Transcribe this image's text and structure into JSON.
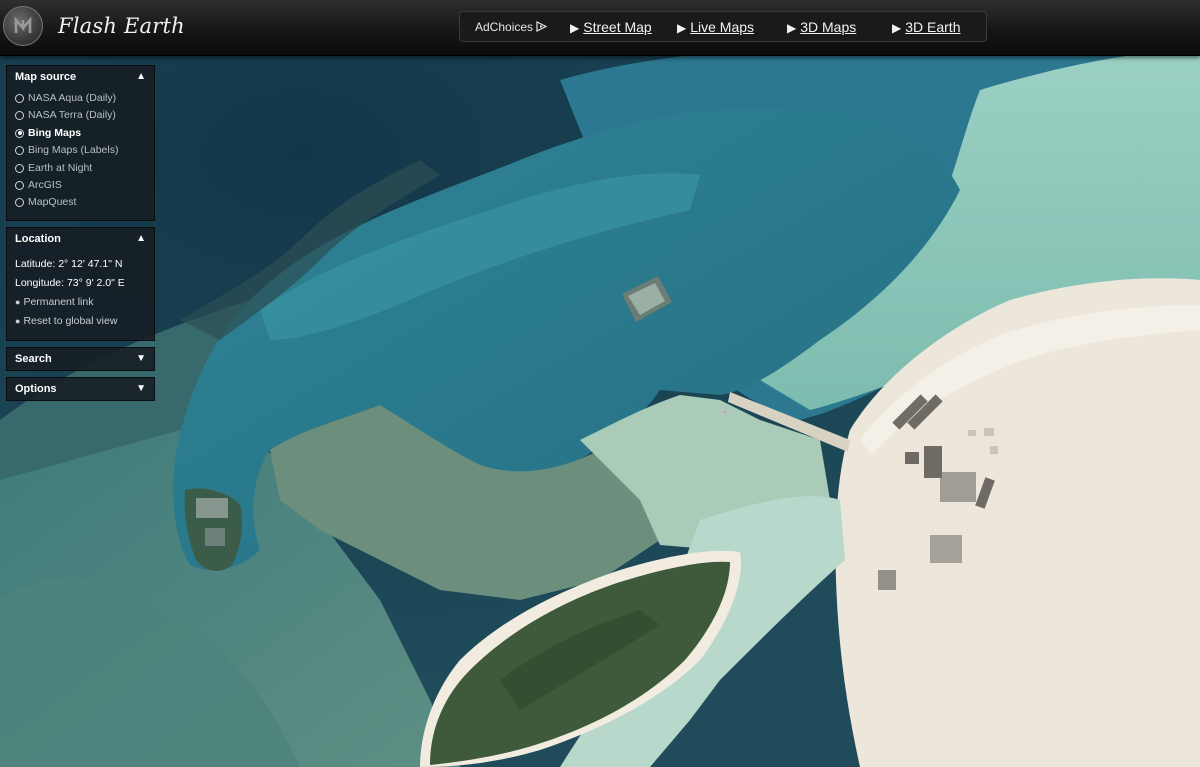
{
  "header": {
    "brand": "Flash Earth",
    "adchoices": "AdChoices",
    "nav": [
      {
        "label": "Street Map"
      },
      {
        "label": "Live Maps"
      },
      {
        "label": "3D Maps"
      },
      {
        "label": "3D Earth"
      }
    ]
  },
  "map_source": {
    "title": "Map source",
    "options": [
      {
        "label": "NASA Aqua (Daily)",
        "selected": false
      },
      {
        "label": "NASA Terra (Daily)",
        "selected": false
      },
      {
        "label": "Bing Maps",
        "selected": true
      },
      {
        "label": "Bing Maps (Labels)",
        "selected": false
      },
      {
        "label": "Earth at Night",
        "selected": false
      },
      {
        "label": "ArcGIS",
        "selected": false
      },
      {
        "label": "MapQuest",
        "selected": false
      }
    ]
  },
  "location": {
    "title": "Location",
    "latitude": "Latitude: 2° 12' 47.1\" N",
    "longitude": "Longitude: 73° 9' 2.0\" E",
    "permanent_link": "Permanent link",
    "reset_link": "Reset to global view"
  },
  "search": {
    "title": "Search"
  },
  "options": {
    "title": "Options"
  },
  "icons": {
    "logo": "flash-earth-logo",
    "adchoices": "adchoices-icon",
    "nav_arrow": "play-arrow-icon",
    "expanded": "caret-up-icon",
    "collapsed": "caret-down-icon",
    "map_cursor": "crosshair-icon"
  },
  "colors": {
    "deep_ocean": "#163a4e",
    "lagoon": "#2f7f92",
    "shallow_reef": "#7fb8a8",
    "sand": "#ece8dc",
    "vegetation": "#3f5a3a",
    "panel_bg": "#161c22",
    "header_bg": "#141414"
  }
}
